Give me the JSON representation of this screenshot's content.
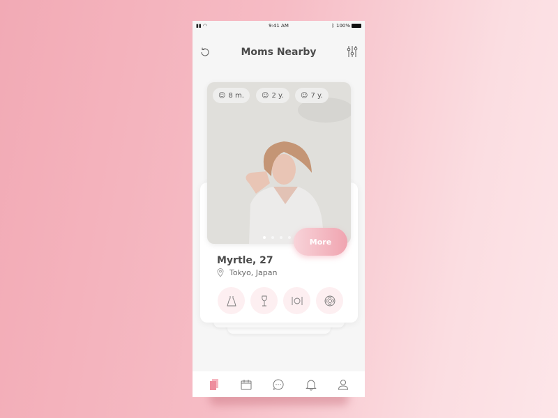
{
  "status": {
    "time": "9:41 AM",
    "battery": "100%"
  },
  "header": {
    "title": "Moms Nearby",
    "left_icon": "refresh-icon",
    "right_icon": "filter-sliders-icon"
  },
  "profile": {
    "children": [
      {
        "label": "8 m.",
        "icon": "baby-icon"
      },
      {
        "label": "2 y.",
        "icon": "baby-girl-icon"
      },
      {
        "label": "7 y.",
        "icon": "baby-icon"
      }
    ],
    "photo_pages": 4,
    "photo_active": 1,
    "more_label": "More",
    "name": "Myrtle, 27",
    "location": "Tokyo, Japan",
    "interests": [
      "dress-icon",
      "wine-glass-icon",
      "dining-icon",
      "film-reel-icon"
    ],
    "accent": "#f0a4b0"
  },
  "tabbar": {
    "items": [
      "cards-icon",
      "calendar-icon",
      "chat-icon",
      "bell-icon",
      "user-icon"
    ],
    "active": 0
  }
}
